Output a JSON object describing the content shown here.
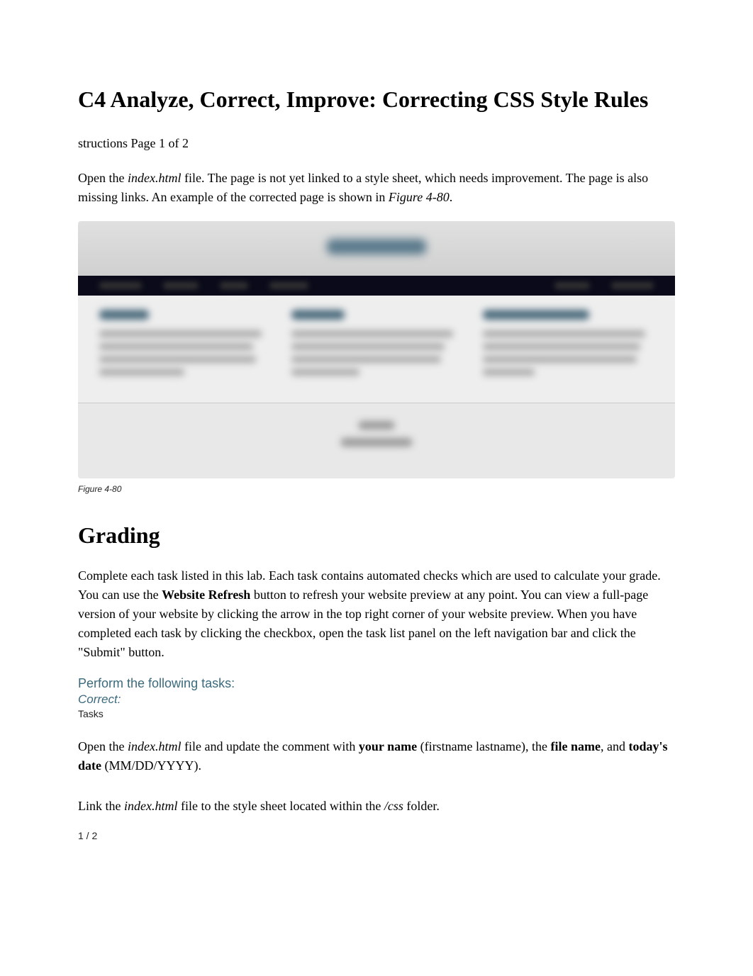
{
  "title": "C4 Analyze, Correct, Improve: Correcting CSS Style Rules",
  "subtitle": "structions Page 1 of 2",
  "intro": {
    "part1": "Open the ",
    "file1": "index.html",
    "part2": " file. The page is not yet linked to a style sheet, which needs improvement. The page is also missing links. An example of the corrected page is shown in ",
    "figref": "Figure 4-80",
    "part3": "."
  },
  "figure_caption": "Figure 4-80",
  "grading_heading": "Grading",
  "grading_body": {
    "part1": "Complete each task listed in this lab. Each task contains automated checks which are used to calculate your grade. You can use the ",
    "bold1": "Website Refresh",
    "part2": " button to refresh your website preview at any point. You can view a full-page version of your website by clicking the arrow in the top right corner of your website preview. When you have completed each task by clicking the checkbox, open the task list panel on the left navigation bar and click the \"Submit\" button."
  },
  "tasks_heading": "Perform the following tasks:",
  "correct_label": "Correct:",
  "tasks_label": "Tasks",
  "task1": {
    "part1": "Open the ",
    "file": "index.html",
    "part2": " file and update the comment with ",
    "bold1": "your name",
    "part3": " (firstname lastname), the ",
    "bold2": "file name",
    "part4": ", and ",
    "bold3": "today's date",
    "part5": " (MM/DD/YYYY)."
  },
  "task2": {
    "part1": "Link the ",
    "file": "index.html",
    "part2": " file to the style sheet located within the ",
    "folder": "/css",
    "part3": " folder."
  },
  "page_number": "1 / 2"
}
